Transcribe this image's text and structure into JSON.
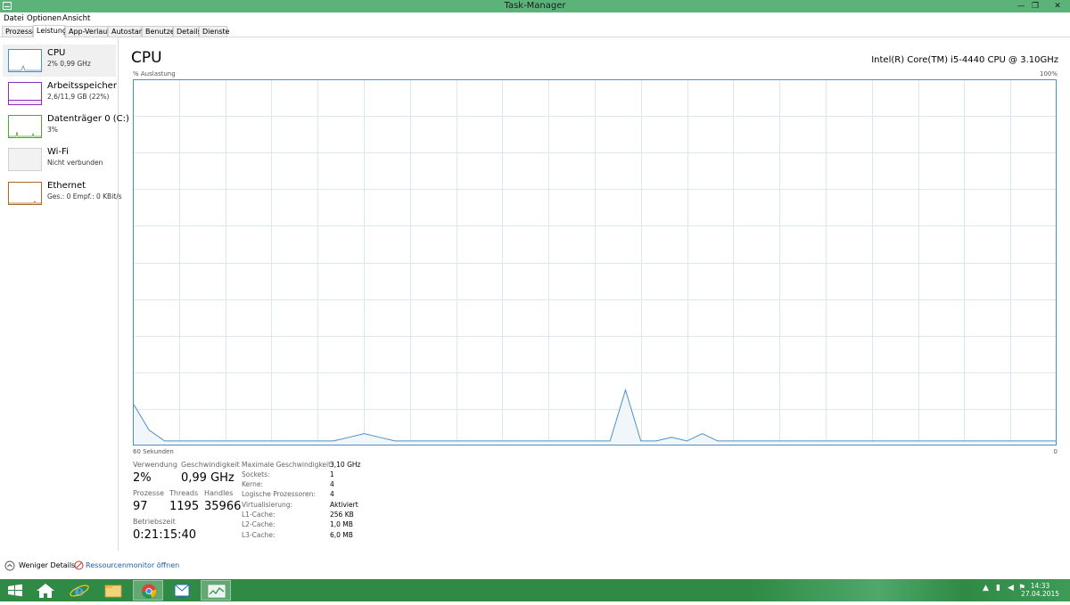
{
  "window": {
    "title": "Task-Manager",
    "controls": {
      "minimize": "—",
      "restore": "❐",
      "close": "✕"
    }
  },
  "menu": [
    "Datei",
    "Optionen",
    "Ansicht"
  ],
  "tabs": [
    "Prozesse",
    "Leistung",
    "App-Verlauf",
    "Autostart",
    "Benutzer",
    "Details",
    "Dienste"
  ],
  "active_tab": "Leistung",
  "sidebar": {
    "items": [
      {
        "name": "CPU",
        "sub": "2% 0,99 GHz",
        "color": "#4a90c8",
        "selected": true
      },
      {
        "name": "Arbeitsspeicher",
        "sub": "2,6/11,9 GB (22%)",
        "color": "#8b2fb8",
        "selected": false
      },
      {
        "name": "Datenträger 0 (C:)",
        "sub": "3%",
        "color": "#4fa82c",
        "selected": false
      },
      {
        "name": "Wi-Fi",
        "sub": "Nicht verbunden",
        "color": "#bbbbbb",
        "selected": false
      },
      {
        "name": "Ethernet",
        "sub": "Ges.: 0 Empf.: 0 KBit/s",
        "color": "#a8692a",
        "selected": false
      }
    ]
  },
  "main": {
    "title": "CPU",
    "cpu_model": "Intel(R) Core(TM) i5-4440 CPU @ 3.10GHz",
    "y_label": "% Auslastung",
    "y_max": "100%",
    "x_label": "60 Sekunden",
    "x_min": "0"
  },
  "chart_data": {
    "type": "area",
    "ylim": [
      0,
      100
    ],
    "grid": true,
    "color": "#4a90c8",
    "fill": "#f1f6fa",
    "series": [
      {
        "values": [
          11,
          4,
          1,
          1,
          1,
          1,
          1,
          1,
          1,
          1,
          1,
          1,
          1,
          1,
          2,
          3,
          2,
          1,
          1,
          1,
          1,
          1,
          1,
          1,
          1,
          1,
          1,
          1,
          1,
          1,
          1,
          1,
          15,
          1,
          1,
          2,
          1,
          3,
          1,
          1,
          1,
          1,
          1,
          1,
          1,
          1,
          1,
          1,
          1,
          1,
          1,
          1,
          1,
          1,
          1,
          1,
          1,
          1,
          1,
          1,
          1
        ]
      }
    ]
  },
  "stats": {
    "verwendung": {
      "label": "Verwendung",
      "value": "2%"
    },
    "geschwindigkeit": {
      "label": "Geschwindigkeit",
      "value": "0,99 GHz"
    },
    "prozesse": {
      "label": "Prozesse",
      "value": "97"
    },
    "threads": {
      "label": "Threads",
      "value": "1195"
    },
    "handles": {
      "label": "Handles",
      "value": "35966"
    },
    "betriebszeit": {
      "label": "Betriebszeit",
      "value": "0:21:15:40"
    }
  },
  "details": [
    {
      "key": "Maximale Geschwindigkeit:",
      "value": "3,10 GHz"
    },
    {
      "key": "Sockets:",
      "value": "1"
    },
    {
      "key": "Kerne:",
      "value": "4"
    },
    {
      "key": "Logische Prozessoren:",
      "value": "4"
    },
    {
      "key": "Virtualisierung:",
      "value": "Aktiviert"
    },
    {
      "key": "L1-Cache:",
      "value": "256 KB"
    },
    {
      "key": "L2-Cache:",
      "value": "1,0 MB"
    },
    {
      "key": "L3-Cache:",
      "value": "6,0 MB"
    }
  ],
  "footer": {
    "fewer_details": "Weniger Details",
    "resource_monitor": "Ressourcenmonitor öffnen"
  },
  "taskbar": {
    "apps": [
      "start-icon",
      "home-icon",
      "internet-explorer-icon",
      "file-explorer-icon",
      "chrome-icon",
      "outlook-icon",
      "task-manager-icon"
    ],
    "time": "14:33",
    "date": "27.04.2015"
  }
}
